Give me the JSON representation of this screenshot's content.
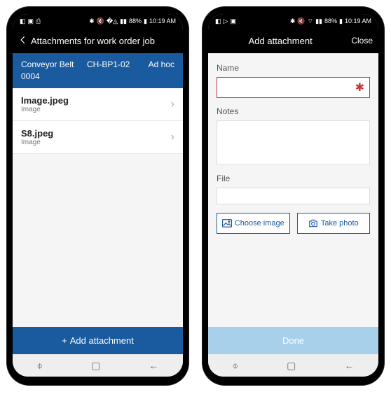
{
  "status": {
    "battery_pct": "88%",
    "time": "10:19 AM"
  },
  "left": {
    "title": "Attachments for work order job",
    "context": {
      "asset": "Conveyor Belt 0004",
      "code": "CH-BP1-02",
      "type": "Ad hoc"
    },
    "items": [
      {
        "name": "Image.jpeg",
        "type": "Image"
      },
      {
        "name": "S8.jpeg",
        "type": "Image"
      }
    ],
    "add_button": "Add attachment"
  },
  "right": {
    "title": "Add attachment",
    "close": "Close",
    "labels": {
      "name": "Name",
      "notes": "Notes",
      "file": "File"
    },
    "values": {
      "name": "",
      "notes": ""
    },
    "buttons": {
      "choose_image": "Choose image",
      "take_photo": "Take photo",
      "done": "Done"
    }
  }
}
